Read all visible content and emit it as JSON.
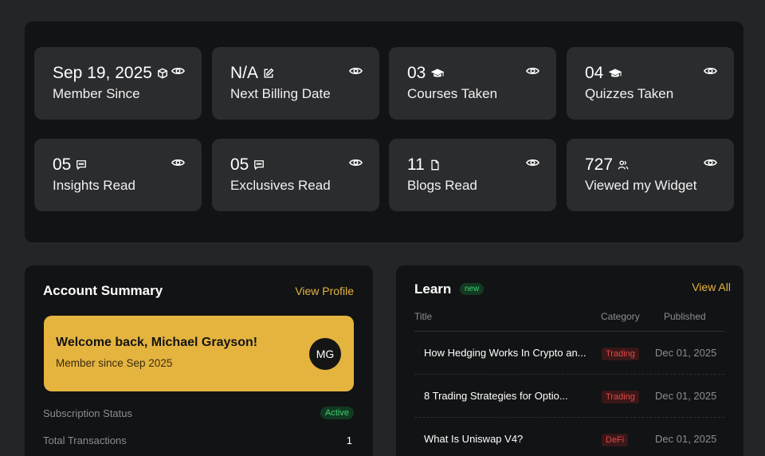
{
  "stats": [
    {
      "value": "Sep 19, 2025",
      "label": "Member Since",
      "icon": "cube-icon"
    },
    {
      "value": "N/A",
      "label": "Next Billing Date",
      "icon": "edit-icon"
    },
    {
      "value": "03",
      "label": "Courses Taken",
      "icon": "graduation-cap-icon"
    },
    {
      "value": "04",
      "label": "Quizzes Taken",
      "icon": "graduation-cap-icon"
    },
    {
      "value": "05",
      "label": "Insights Read",
      "icon": "message-icon"
    },
    {
      "value": "05",
      "label": "Exclusives Read",
      "icon": "message-icon"
    },
    {
      "value": "11",
      "label": "Blogs Read",
      "icon": "document-icon"
    },
    {
      "value": "727",
      "label": "Viewed my Widget",
      "icon": "users-icon"
    }
  ],
  "account": {
    "title": "Account Summary",
    "view_profile": "View Profile",
    "welcome_title": "Welcome back, Michael Grayson!",
    "welcome_sub": "Member since Sep 2025",
    "avatar_initials": "MG",
    "rows": [
      {
        "label": "Subscription Status",
        "value": "Active"
      },
      {
        "label": "Total Transactions",
        "value": "1"
      }
    ]
  },
  "learn": {
    "title": "Learn",
    "badge": "new",
    "view_all": "View All",
    "columns": [
      "Title",
      "Category",
      "Published"
    ],
    "rows": [
      {
        "title": "How Hedging Works In Crypto an...",
        "category": "Trading",
        "published": "Dec 01, 2025"
      },
      {
        "title": "8 Trading Strategies for Optio...",
        "category": "Trading",
        "published": "Dec 01, 2025"
      },
      {
        "title": "What Is Uniswap V4?",
        "category": "DeFi",
        "published": "Dec 01, 2025"
      }
    ]
  },
  "colors": {
    "background": "#242527",
    "panel": "#121314",
    "card": "#2b2c2e",
    "accent": "#e5b43f",
    "link": "#e6b440",
    "success": "#3fcf6e",
    "danger": "#e04848"
  }
}
